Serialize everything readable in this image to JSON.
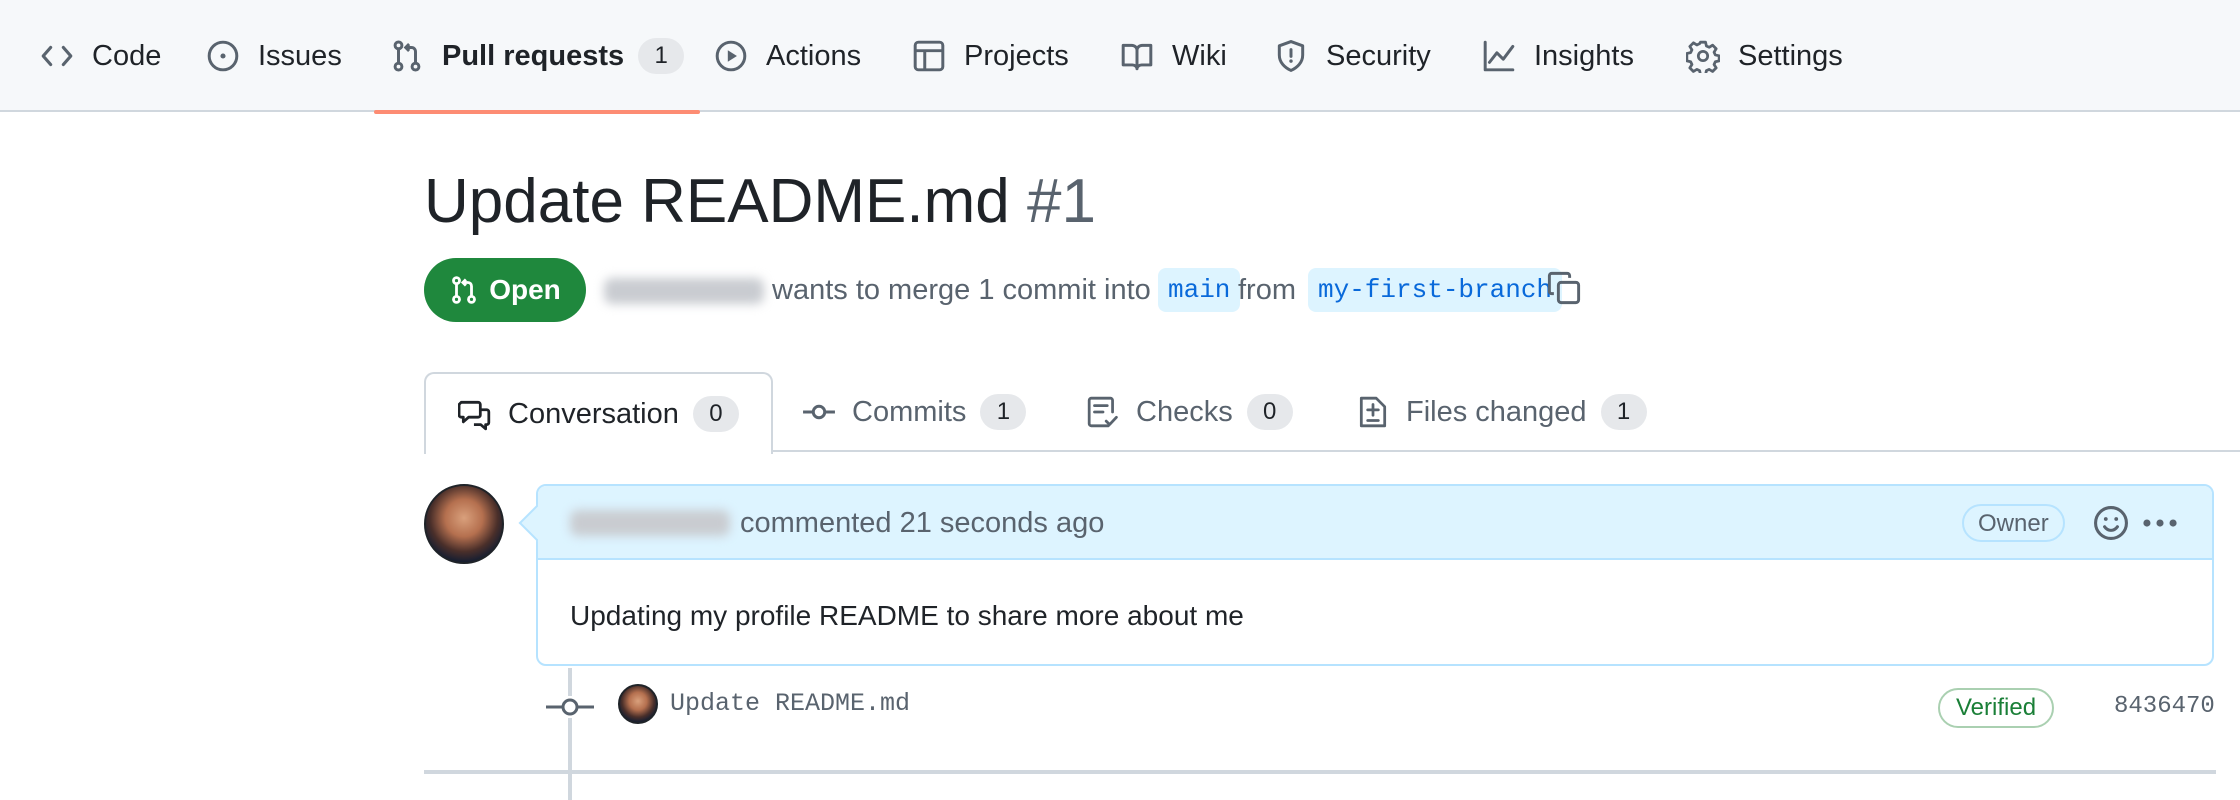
{
  "repo_nav": {
    "items": [
      {
        "label": "Code",
        "icon": "code-icon"
      },
      {
        "label": "Issues",
        "icon": "issue-opened-icon"
      },
      {
        "label": "Pull requests",
        "icon": "git-pull-request-icon",
        "count": "1",
        "selected": true
      },
      {
        "label": "Actions",
        "icon": "play-icon"
      },
      {
        "label": "Projects",
        "icon": "table-icon"
      },
      {
        "label": "Wiki",
        "icon": "book-icon"
      },
      {
        "label": "Security",
        "icon": "shield-icon"
      },
      {
        "label": "Insights",
        "icon": "graph-icon"
      },
      {
        "label": "Settings",
        "icon": "gear-icon"
      }
    ]
  },
  "pr": {
    "title": "Update README.md",
    "number": "#1",
    "state": "Open",
    "meta": {
      "merge_text": "wants to merge 1 commit into",
      "base_branch": "main",
      "from_text": "from",
      "head_branch": "my-first-branch"
    }
  },
  "tabs": [
    {
      "label": "Conversation",
      "icon": "comment-discussion-icon",
      "count": "0",
      "active": true
    },
    {
      "label": "Commits",
      "icon": "git-commit-icon",
      "count": "1"
    },
    {
      "label": "Checks",
      "icon": "checklist-icon",
      "count": "0"
    },
    {
      "label": "Files changed",
      "icon": "file-diff-icon",
      "count": "1"
    }
  ],
  "comment": {
    "meta": "commented 21 seconds ago",
    "badge": "Owner",
    "body": "Updating my profile README to share more about me"
  },
  "commit": {
    "message": "Update README.md",
    "verified": "Verified",
    "sha": "8436470"
  },
  "colors": {
    "accent_open": "#1f883d",
    "selected_underline": "#fd8c73",
    "branch_bg": "#ddf4ff",
    "link": "#0969da"
  }
}
